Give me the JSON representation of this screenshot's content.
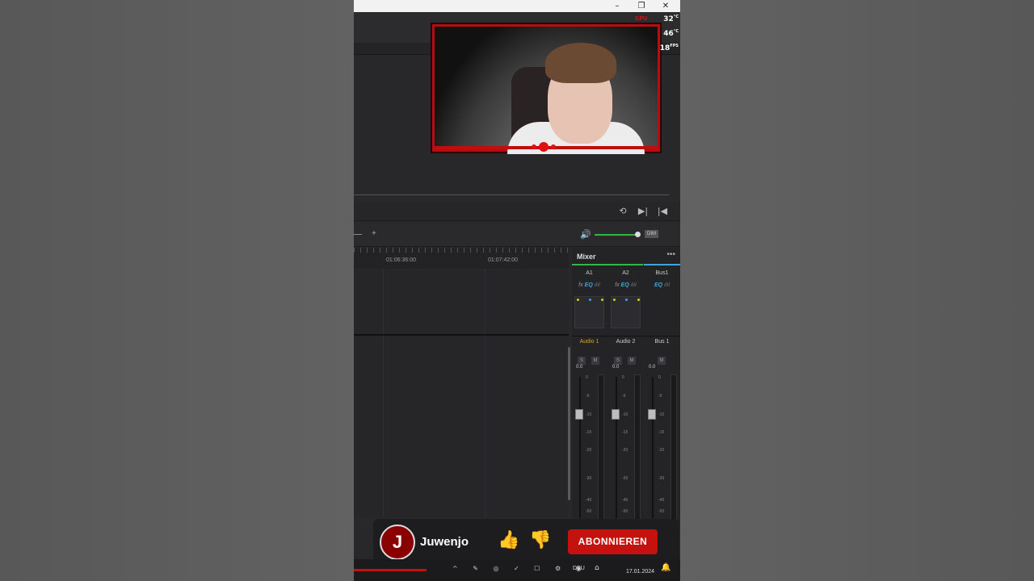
{
  "window": {
    "minimize": "–",
    "restore": "❐",
    "close": "✕"
  },
  "overlay": {
    "gpu": "GPU",
    "temp1": "32",
    "temp1_unit": "°C",
    "temp2": "46",
    "temp2_unit": "°C",
    "fps": "18",
    "fps_unit": "FPS"
  },
  "timeline": {
    "tc1": "01:06:36:00",
    "tc2": "01:07:42:00"
  },
  "toolbar": {
    "dim": "DIM",
    "plus": "+"
  },
  "mixer": {
    "title": "Mixer",
    "menu": "•••",
    "channels": [
      {
        "label": "A1",
        "fx": "fx",
        "eq": "EQ",
        "name": "Audio 1",
        "s": "S",
        "m": "M",
        "gain": "0.0",
        "accent": "#2fb84a"
      },
      {
        "label": "A2",
        "fx": "fx",
        "eq": "EQ",
        "name": "Audio 2",
        "s": "S",
        "m": "M",
        "gain": "0.0",
        "accent": "#2fb84a"
      },
      {
        "label": "Bus1",
        "fx": "",
        "eq": "EQ",
        "name": "Bus 1",
        "s": "",
        "m": "M",
        "gain": "0.0",
        "accent": "#3aa8d8"
      }
    ],
    "scale": [
      "0",
      "-5",
      "-10",
      "-15",
      "-20",
      "-30",
      "-40",
      "-50"
    ]
  },
  "subscribe_bar": {
    "avatar_letter": "J",
    "channel": "Juwenjo",
    "subscribe_label": "ABONNIEREN"
  },
  "taskbar": {
    "lang": "DEU",
    "date": "17.01.2024"
  }
}
